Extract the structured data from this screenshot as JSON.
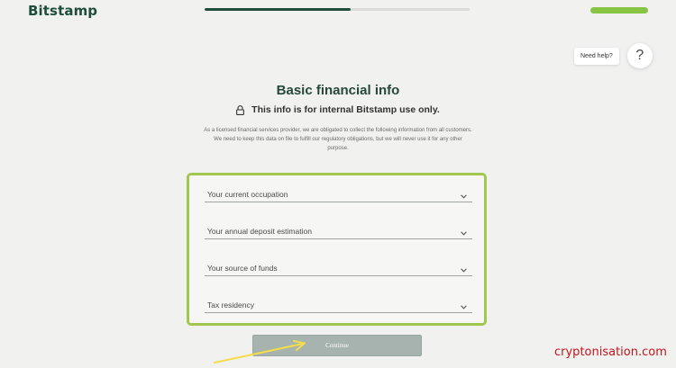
{
  "brand": {
    "logo_text": "Bitstamp"
  },
  "progress": {
    "fraction": 0.55,
    "color": "#1f4d3d"
  },
  "help": {
    "label": "Need help?",
    "icon_glyph": "?"
  },
  "page": {
    "title": "Basic financial info",
    "subtitle": "This info is for internal Bitstamp use only.",
    "disclaimer": "As a licensed financial services provider, we are obligated to collect the following information from all customers. We need to keep this data on file to fulfill our regulatory obligations, but we will never use it for any other purpose."
  },
  "form": {
    "highlight_color": "#a1c751",
    "fields": [
      {
        "label": "Your current occupation",
        "icon": "chevron-down-icon"
      },
      {
        "label": "Your annual deposit estimation",
        "icon": "chevron-down-icon"
      },
      {
        "label": "Your source of funds",
        "icon": "chevron-down-icon"
      },
      {
        "label": "Tax residency",
        "icon": "chevron-down-icon"
      }
    ]
  },
  "actions": {
    "continue_label": "Continue"
  },
  "annotation": {
    "arrow_color": "#f2dd4a"
  },
  "watermark": {
    "text": "cryptonisation.com",
    "color": "#c2151b"
  }
}
